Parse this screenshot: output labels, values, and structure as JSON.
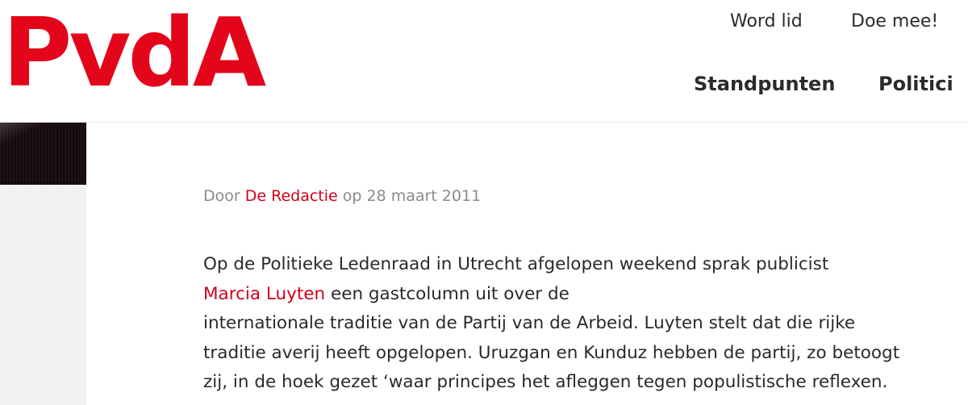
{
  "brand": {
    "logo_text": "PvdA",
    "accent_color": "#e3061a"
  },
  "header": {
    "top_nav": [
      {
        "label": "Word lid"
      },
      {
        "label": "Doe mee!"
      }
    ],
    "main_nav": [
      {
        "label": "Standpunten"
      },
      {
        "label": "Politici"
      }
    ]
  },
  "article": {
    "byline": {
      "prefix": "Door",
      "author": "De Redactie",
      "date_text": "op 28 maart 2011"
    },
    "paragraph": {
      "line1": "Op de Politieke Ledenraad in Utrecht afgelopen weekend sprak publicist",
      "link": "Marcia Luyten",
      "line2_rest": "een gastcolumn uit over de",
      "line3": "internationale traditie van de Partij van de Arbeid. Luyten stelt dat die rijke",
      "line4": "traditie averij heeft opgelopen. Uruzgan en Kunduz hebben de partij, zo betoogt",
      "line5": "zij, in de hoek gezet ‘waar principes het afleggen tegen populistische reflexen."
    }
  }
}
